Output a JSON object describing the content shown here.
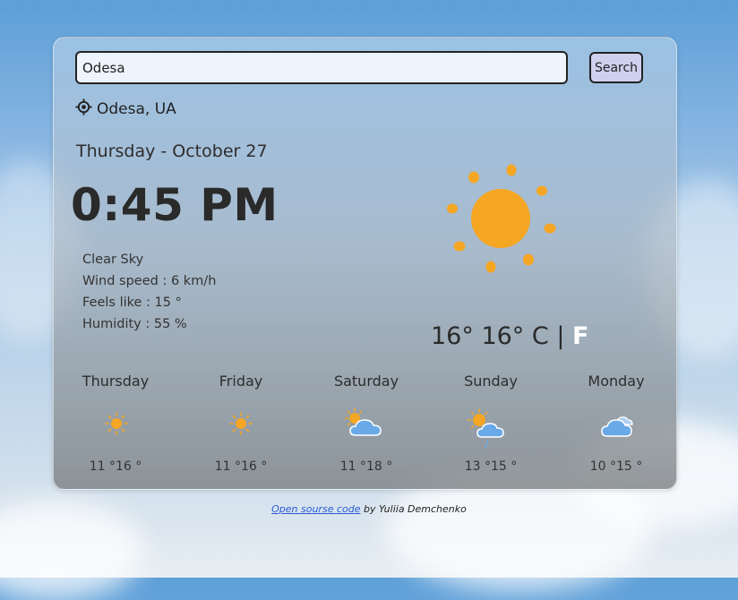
{
  "search": {
    "value": "Odesa",
    "button_label": "Search"
  },
  "location": {
    "icon": "location-crosshair-icon",
    "text": "Odesa, UA"
  },
  "current": {
    "date": "Thursday - October 27",
    "time": "0:45 PM",
    "description": "Clear Sky",
    "wind": "Wind speed : 6 km/h",
    "feels_like": "Feels like : 15 °",
    "humidity": "Humidity : 55 %",
    "icon": "sun-icon",
    "temp_text": "16° 16° C",
    "separator": "|",
    "unit_f": "F"
  },
  "forecast": [
    {
      "day": "Thursday",
      "temps": "11 °16 °",
      "icon": "sun-icon"
    },
    {
      "day": "Friday",
      "temps": "11 °16 °",
      "icon": "sun-icon"
    },
    {
      "day": "Saturday",
      "temps": "11 °18 °",
      "icon": "sun-cloud-icon"
    },
    {
      "day": "Sunday",
      "temps": "13 °15 °",
      "icon": "sun-cloud-rain-icon"
    },
    {
      "day": "Monday",
      "temps": "10 °15 °",
      "icon": "cloud-icon"
    }
  ],
  "footer": {
    "link": "Open sourse code",
    "text": " by Yuliia Demchenko"
  },
  "colors": {
    "sun": "#f5a623",
    "cloud": "#6aa9e8",
    "accent_link": "#2a5bd7"
  }
}
